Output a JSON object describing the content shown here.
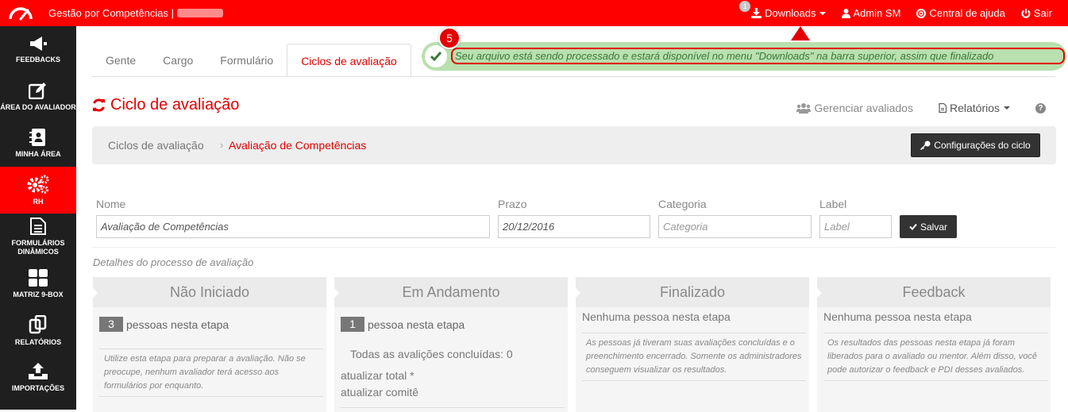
{
  "header": {
    "app_title": "Gestão por Competências |",
    "downloads_label": "Downloads",
    "downloads_badge": "1",
    "user_label": "Admin SM",
    "help_label": "Central de ajuda",
    "logout_label": "Sair",
    "brand_color": "#ff0000"
  },
  "sidebar": {
    "items": [
      {
        "label": "FEEDBACKS",
        "icon": "megaphone-icon"
      },
      {
        "label": "ÁREA DO AVALIADOR",
        "icon": "edit-icon"
      },
      {
        "label": "MINHA ÁREA",
        "icon": "address-book-icon"
      },
      {
        "label": "RH",
        "icon": "gears-icon"
      },
      {
        "label": "FORMULÁRIOS",
        "label2": "DINÂMICOS",
        "icon": "document-icon"
      },
      {
        "label": "MATRIZ 9-BOX",
        "icon": "grid-icon"
      },
      {
        "label": "RELATÓRIOS",
        "icon": "copy-icon"
      },
      {
        "label": "IMPORTAÇÕES",
        "icon": "upload-icon"
      }
    ]
  },
  "tabs": [
    {
      "label": "Gente"
    },
    {
      "label": "Cargo"
    },
    {
      "label": "Formulário"
    },
    {
      "label": "Ciclos de avaliação"
    }
  ],
  "notification": {
    "step_number": "5",
    "message": "Seu arquivo está sendo processado e estará disponível no menu \"Downloads\" na barra superior, assim que finalizado"
  },
  "page": {
    "title": "Ciclo de avaliação",
    "manage_label": "Gerenciar avaliados",
    "reports_label": "Relatórios",
    "help_glyph": "?"
  },
  "breadcrumb": {
    "root": "Ciclos de avaliação",
    "separator": "›",
    "current": "Avaliação de Competências",
    "config_button": "Configurações do ciclo"
  },
  "form": {
    "name_label": "Nome",
    "name_value": "Avaliação de Competências",
    "deadline_label": "Prazo",
    "deadline_value": "20/12/2016",
    "category_label": "Categoria",
    "category_placeholder": "Categoria",
    "tag_label": "Label",
    "tag_placeholder": "Label",
    "save_label": "Salvar",
    "details_label": "Detalhes do processo de avaliação"
  },
  "stages": [
    {
      "title": "Não Iniciado",
      "count": "3",
      "count_text": "pessoas nesta etapa",
      "description": "Utilize esta etapa para preparar a avaliação. Não se preocupe, nenhum avaliador terá acesso aos formulários por enquanto."
    },
    {
      "title": "Em Andamento",
      "count": "1",
      "count_text": "pessoa nesta etapa",
      "completed": "Todas as avalições concluídas: 0",
      "update_total": "atualizar total *",
      "update_committee": "atualizar comitê"
    },
    {
      "title": "Finalizado",
      "none_text": "Nenhuma pessoa nesta etapa",
      "description": "As pessoas já tiveram suas avaliações concluídas e o preenchimento encerrado. Somente os administradores conseguem visualizar os resultados."
    },
    {
      "title": "Feedback",
      "none_text": "Nenhuma pessoa nesta etapa",
      "description": "Os resultados das pessoas nesta etapa já foram liberados para o avaliado ou mentor. Além disso, você pode autorizar o feedback e PDI desses avaliados."
    }
  ]
}
